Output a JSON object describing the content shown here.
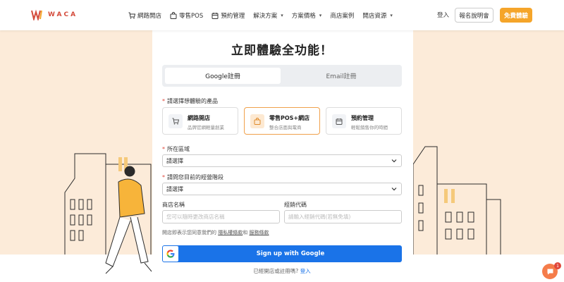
{
  "header": {
    "logo_text": "WACA",
    "nav": [
      {
        "label": "網路開店",
        "icon": "cart-icon"
      },
      {
        "label": "零售POS",
        "icon": "bag-icon"
      },
      {
        "label": "預約管理",
        "icon": "calendar-icon"
      },
      {
        "label": "解決方案",
        "dropdown": true
      },
      {
        "label": "方案價格",
        "dropdown": true
      },
      {
        "label": "商店案例"
      },
      {
        "label": "開店資源",
        "dropdown": true
      }
    ],
    "login": "登入",
    "brief_button": "報名說明會",
    "trial_button": "免費體驗"
  },
  "main": {
    "title": "立即體驗全功能！",
    "tabs": [
      {
        "label": "Google註冊",
        "active": true
      },
      {
        "label": "Email註冊",
        "active": false
      }
    ],
    "product_label": "請選擇想體驗的產品",
    "products": [
      {
        "title": "網路開店",
        "subtitle": "品牌官網輕量創業",
        "icon": "cart-icon",
        "selected": false
      },
      {
        "title": "零售POS+網店",
        "subtitle": "整合店面與電商",
        "icon": "bag-icon",
        "selected": true
      },
      {
        "title": "預約管理",
        "subtitle": "輕鬆銷售你的時間",
        "icon": "calendar-icon",
        "selected": false
      }
    ],
    "region_label": "所在區域",
    "region_value": "請選擇",
    "stage_label": "請問您目前的經營階段",
    "stage_value": "請選擇",
    "store_name_label": "商店名稱",
    "store_name_placeholder": "您可以隨時更改商店名稱",
    "dealer_code_label": "經銷代碼",
    "dealer_code_placeholder": "請輸入經銷代碼(若無免填)",
    "terms_prefix": "開店即表示您同意我們的",
    "privacy_link": "隱私權條款",
    "terms_and": "和",
    "service_link": "服務條款",
    "google_button": "Sign up with Google",
    "have_account": "已經開店或註冊嗎?",
    "have_account_login": "登入"
  },
  "chat": {
    "badge": "1"
  },
  "colors": {
    "accent": "#f5a52a",
    "google_blue": "#1a73e8",
    "peach": "#fcebd9",
    "brand_red": "#d44b3b"
  }
}
